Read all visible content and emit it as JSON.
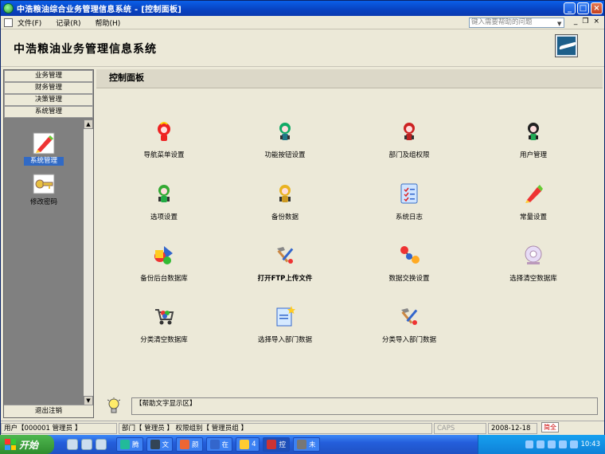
{
  "window": {
    "title": "中浩粮油综合业务管理信息系统 - [控制面板]",
    "buttons": {
      "min": "_",
      "max": "□",
      "close": "×"
    }
  },
  "menubar": {
    "items": [
      "文件(F)",
      "记录(R)",
      "帮助(H)"
    ],
    "help_placeholder": "键入需要帮助的问题",
    "mdi": {
      "min": "_",
      "restore": "❐",
      "close": "×"
    }
  },
  "header": {
    "system_name": "中浩粮油业务管理信息系统"
  },
  "sidebar": {
    "tabs": [
      "业务管理",
      "财务管理",
      "决策管理",
      "系统管理"
    ],
    "items": [
      {
        "label": "系统管理",
        "icon": "pen-icon",
        "selected": true
      },
      {
        "label": "修改密码",
        "icon": "key-icon",
        "selected": false
      }
    ],
    "logout": "退出注销"
  },
  "panel": {
    "title": "控制面板",
    "items": [
      {
        "label": "导航菜单设置",
        "icon": "mascot-red-icon"
      },
      {
        "label": "功能按钮设置",
        "icon": "mascot-teal-icon"
      },
      {
        "label": "部门及组权限",
        "icon": "mascot-red2-icon"
      },
      {
        "label": "用户管理",
        "icon": "mascot-green-icon"
      },
      {
        "label": "选项设置",
        "icon": "mascot-green2-icon"
      },
      {
        "label": "备份数据",
        "icon": "mascot-yellow-icon"
      },
      {
        "label": "系统日志",
        "icon": "checklist-icon"
      },
      {
        "label": "常量设置",
        "icon": "pen-icon"
      },
      {
        "label": "备份后台数据库",
        "icon": "shapes-icon"
      },
      {
        "label": "打开FTP上传文件",
        "icon": "tools-icon",
        "bold": true
      },
      {
        "label": "数据交换设置",
        "icon": "molecule-icon"
      },
      {
        "label": "选择清空数据库",
        "icon": "disc-icon"
      },
      {
        "label": "分类清空数据库",
        "icon": "cart-icon"
      },
      {
        "label": "选择导入部门数据",
        "icon": "document-star-icon"
      },
      {
        "label": "分类导入部门数据",
        "icon": "tools-icon"
      }
    ],
    "help_text": "【帮助文字显示区】"
  },
  "statusbar": {
    "user": "用户【000001 管理员 】",
    "dept": "部门【 管理员 】 权限组别【 管理员组 】",
    "caps": "CAPS",
    "date": "2008-12-18"
  },
  "ime": {
    "text": "简全"
  },
  "taskbar": {
    "start": "开始",
    "tasks": [
      {
        "label": "腾",
        "color": "#2b9"
      },
      {
        "label": "文",
        "color": "#345"
      },
      {
        "label": "颜",
        "color": "#e63"
      },
      {
        "label": "在",
        "color": "#36c"
      },
      {
        "label": "4",
        "color": "#fc3"
      },
      {
        "label": "控",
        "color": "#c33",
        "active": true
      },
      {
        "label": "未",
        "color": "#777"
      }
    ],
    "clock": "10:43"
  }
}
